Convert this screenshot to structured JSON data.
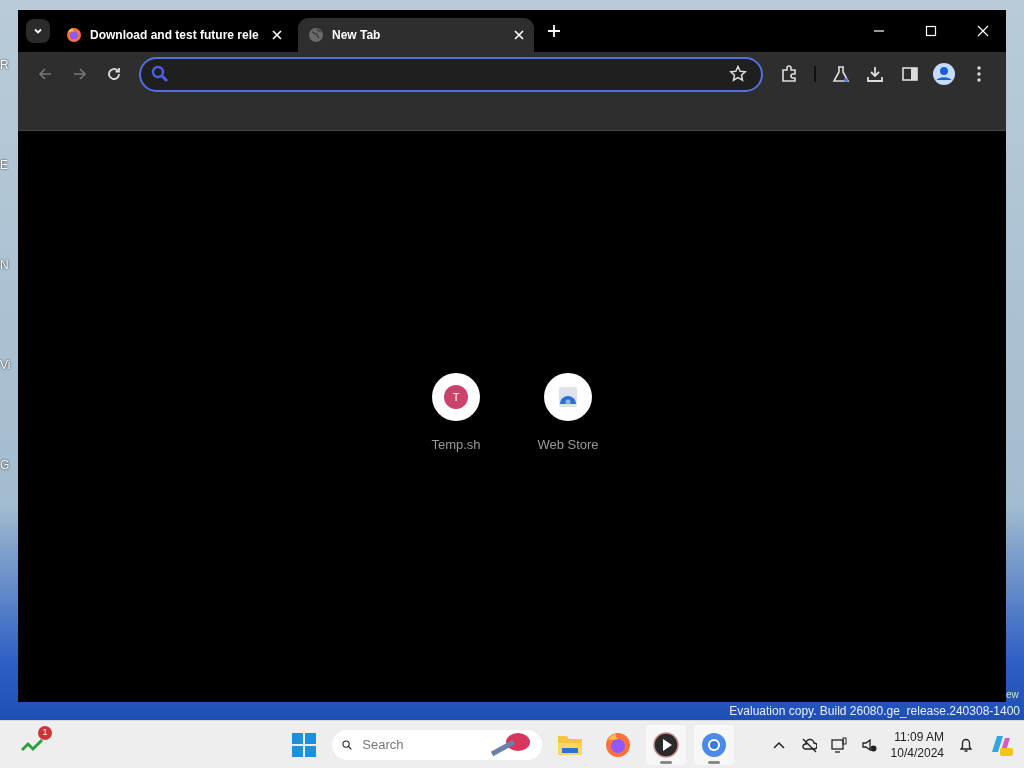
{
  "desktop_labels": [
    "R",
    "E",
    "N",
    "Vi",
    "G"
  ],
  "tabs": [
    {
      "title": "Download and test future rele",
      "selected": false
    },
    {
      "title": "New Tab",
      "selected": true
    }
  ],
  "omnibox": {
    "focused": true
  },
  "shortcuts": [
    {
      "label": "Temp.sh",
      "kind": "letter",
      "letter": "T"
    },
    {
      "label": "Web Store",
      "kind": "store"
    }
  ],
  "watermark": {
    "line_1": "ew",
    "line_2": "Evaluation copy. Build 26080.ge_release.240308-1400"
  },
  "taskbar": {
    "widget_badge": "1",
    "search_placeholder": "Search",
    "apps": [
      {
        "kind": "files",
        "running": false
      },
      {
        "kind": "firefox",
        "running": false
      },
      {
        "kind": "player",
        "running": true
      },
      {
        "kind": "chrome",
        "running": true
      }
    ],
    "time": "11:09 AM",
    "date": "10/4/2024"
  }
}
